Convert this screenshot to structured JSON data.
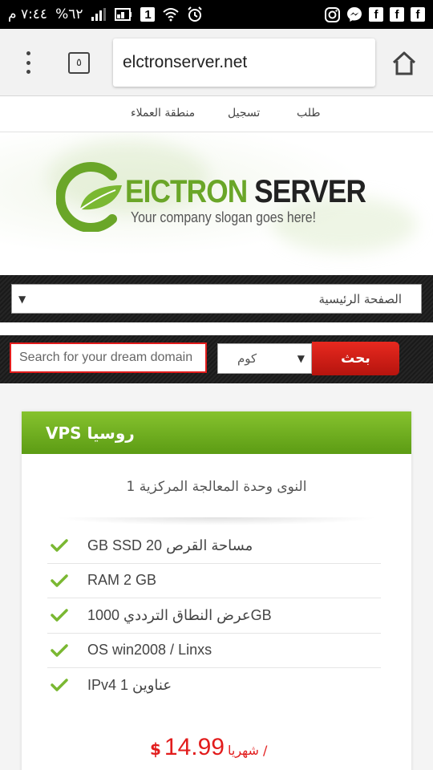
{
  "status_bar": {
    "time": "٧:٤٤ م",
    "battery": "%٦٢",
    "notif_badge": "1"
  },
  "browser": {
    "url": "elctronserver.net",
    "tab_count": "٥"
  },
  "site_nav": {
    "order": "طلب",
    "register": "تسجيل",
    "client_area": "منطقة العملاء"
  },
  "logo": {
    "word1": "EICTRON",
    "word2": "SERVER",
    "slogan": "Your company slogan goes here!"
  },
  "menu": {
    "selected": "الصفحة الرئيسية"
  },
  "domain_search": {
    "placeholder": "Search for your dream domain",
    "tld_selected": "كوم",
    "button_label": "بحث"
  },
  "plan": {
    "title": "روسيا VPS",
    "cpu_cores": "النوى وحدة المعالجة المركزية 1",
    "features": [
      "GB SSD مساحة القرص 20",
      "RAM 2 GB",
      "عرض النطاق الترددي 1000GB",
      "OS win2008 / Linxs",
      "IPv4 1 عناوين"
    ],
    "price_currency": "$",
    "price_amount": "14.99",
    "price_period": "/ شهريا"
  },
  "colors": {
    "brand_green": "#6aa628",
    "accent_red": "#e21c1c",
    "dark_bar": "#1e1e1e"
  },
  "icons": [
    "battery-icon",
    "signal-icon",
    "notification-badge-icon",
    "wifi-icon",
    "alarm-icon",
    "instagram-icon",
    "messenger-icon",
    "facebook-icon",
    "menu-dots-icon",
    "tabs-icon",
    "home-icon",
    "checkmark-icon",
    "dropdown-arrow-icon"
  ]
}
